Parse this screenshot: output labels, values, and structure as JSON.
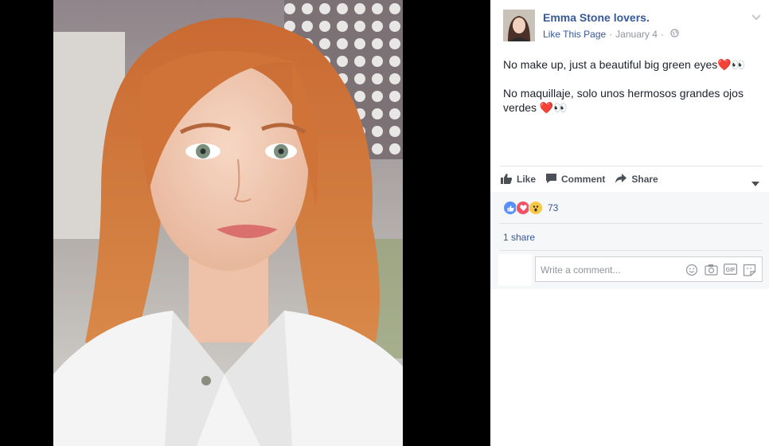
{
  "post": {
    "page_name": "Emma Stone lovers.",
    "like_page_label": "Like This Page",
    "separator": "·",
    "date": "January 4",
    "text_en": "No make up, just a beautiful big green eyes",
    "text_es": "No maquillaje, solo unos hermosos grandes ojos verdes",
    "emoji_heart": "❤️",
    "emoji_eyes": "👀"
  },
  "actions": {
    "like_label": "Like",
    "comment_label": "Comment",
    "share_label": "Share"
  },
  "engagement": {
    "reaction_count": "73",
    "reactions": [
      "like",
      "love",
      "wow"
    ],
    "shares_label": "1 share"
  },
  "comment": {
    "placeholder": "Write a comment..."
  },
  "colors": {
    "link": "#365899",
    "meta": "#90949c",
    "text": "#1d2129",
    "like_blue": "#5890ff",
    "love_red": "#f25268",
    "wow_yellow": "#f7c843"
  },
  "icons": [
    "thumbs-up-icon",
    "comment-bubble-icon",
    "share-arrow-icon",
    "globe-icon",
    "chevron-down-icon",
    "emoji-icon",
    "camera-icon",
    "gif-icon",
    "sticker-icon"
  ]
}
